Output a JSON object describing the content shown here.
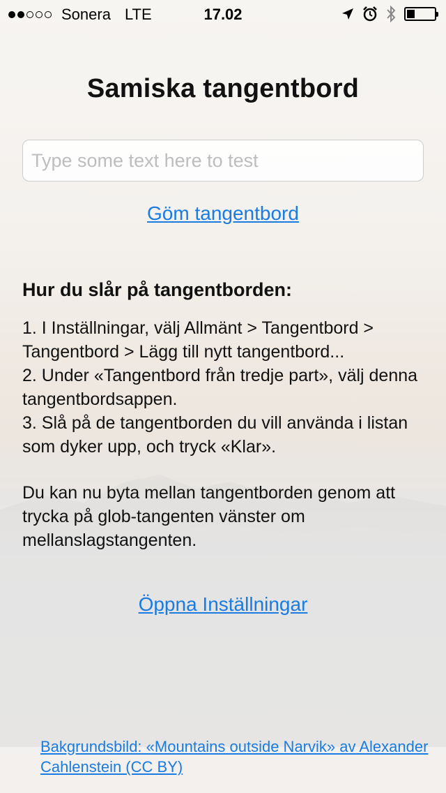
{
  "status_bar": {
    "signal_filled": 2,
    "signal_total": 5,
    "carrier": "Sonera",
    "network": "LTE",
    "time": "17.02",
    "icons": [
      "location-icon",
      "alarm-icon",
      "bluetooth-icon",
      "battery-icon"
    ],
    "battery_level": 0.3
  },
  "title": "Samiska tangentbord",
  "test_input": {
    "value": "",
    "placeholder": "Type some text here to test"
  },
  "hide_keyboard_link": "Göm tangentbord",
  "instructions": {
    "heading": "Hur du slår på tangentborden:",
    "steps": [
      "1. I Inställningar, välj Allmänt > Tangentbord > Tangentbord > Lägg till nytt tangentbord...",
      "2. Under «Tangentbord från tredje part», välj denna tangentbordsappen.",
      "3. Slå på de tangentborden du vill använda i listan som dyker upp, och tryck «Klar»."
    ],
    "note": "Du kan nu byta mellan tangentborden genom att trycka på glob-tangenten vänster om mellanslagstangenten."
  },
  "open_settings_link": "Öppna Inställningar",
  "credit_link": "Bakgrundsbild: «Mountains outside Narvik» av Alexander Cahlenstein (CC BY)",
  "colors": {
    "link": "#1a7be0",
    "text": "#111111",
    "placeholder": "#bdbdbd"
  }
}
